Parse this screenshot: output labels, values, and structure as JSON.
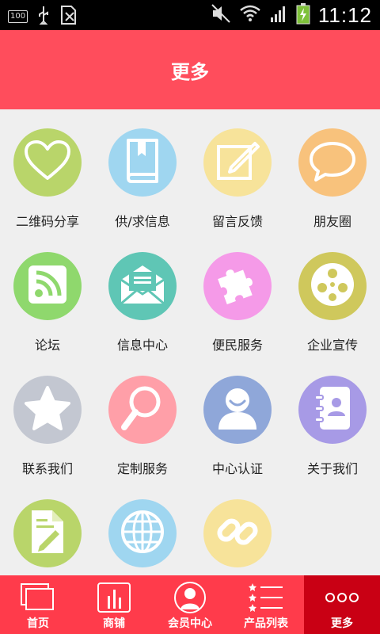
{
  "status_bar": {
    "battery_badge": "100",
    "time": "11:12"
  },
  "header": {
    "title": "更多"
  },
  "grid_items": [
    {
      "label": "二维码分享",
      "icon": "heart-icon",
      "color": "#b9d56a"
    },
    {
      "label": "供/求信息",
      "icon": "book-icon",
      "color": "#9fd6f0"
    },
    {
      "label": "留言反馈",
      "icon": "note-pencil-icon",
      "color": "#f7e39a"
    },
    {
      "label": "朋友圈",
      "icon": "chat-bubble-icon",
      "color": "#f8c27c"
    },
    {
      "label": "论坛",
      "icon": "rss-icon",
      "color": "#8fd86d"
    },
    {
      "label": "信息中心",
      "icon": "envelope-icon",
      "color": "#5fc6b5"
    },
    {
      "label": "便民服务",
      "icon": "puzzle-icon",
      "color": "#f59ae8"
    },
    {
      "label": "企业宣传",
      "icon": "film-reel-icon",
      "color": "#cfc85c"
    },
    {
      "label": "联系我们",
      "icon": "star-icon",
      "color": "#c3c7d1"
    },
    {
      "label": "定制服务",
      "icon": "magnifier-icon",
      "color": "#ff9fa8"
    },
    {
      "label": "中心认证",
      "icon": "user-icon",
      "color": "#8fa7d9"
    },
    {
      "label": "关于我们",
      "icon": "contact-book-icon",
      "color": "#a79ae6"
    },
    {
      "label": "",
      "icon": "document-edit-icon",
      "color": "#b9d56a"
    },
    {
      "label": "",
      "icon": "globe-icon",
      "color": "#9fd6f0"
    },
    {
      "label": "",
      "icon": "chain-link-icon",
      "color": "#f7e39a"
    }
  ],
  "tabs": [
    {
      "label": "首页",
      "icon": "pages-icon",
      "active": false
    },
    {
      "label": "商铺",
      "icon": "bar-chart-icon",
      "active": false
    },
    {
      "label": "会员中心",
      "icon": "member-icon",
      "active": false
    },
    {
      "label": "产品列表",
      "icon": "star-list-icon",
      "active": false
    },
    {
      "label": "更多",
      "icon": "more-dots-icon",
      "active": true
    }
  ]
}
